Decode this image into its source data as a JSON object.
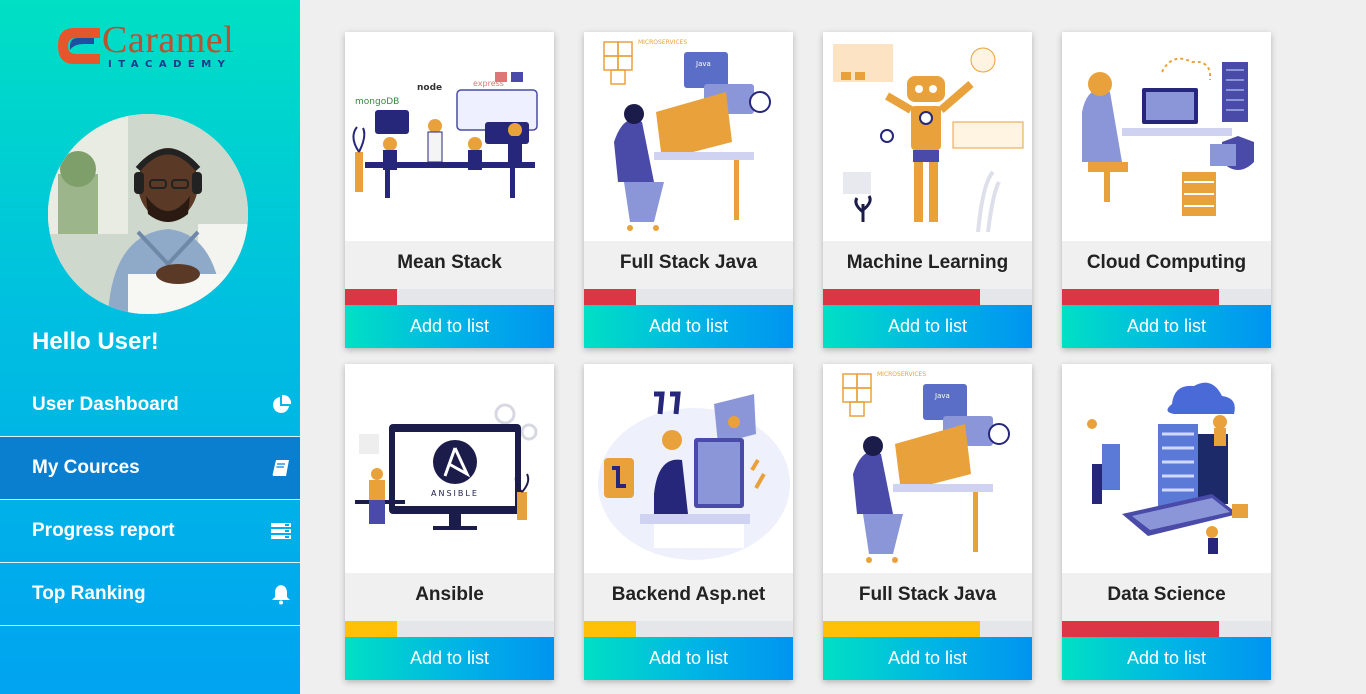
{
  "brand": {
    "name": "Caramel",
    "tagline": "ITACADEMY",
    "colors": {
      "logo_text": "#b9522d",
      "logo_sub": "#1f3a8a"
    }
  },
  "user": {
    "greeting": "Hello User!"
  },
  "sidebar": {
    "items": [
      {
        "label": "User Dashboard",
        "icon": "pie-chart-icon",
        "active": false
      },
      {
        "label": "My Cources",
        "icon": "book-icon",
        "active": true
      },
      {
        "label": "Progress report",
        "icon": "list-icon",
        "active": false
      },
      {
        "label": "Top Ranking",
        "icon": "bell-icon",
        "active": false
      }
    ]
  },
  "courses": [
    {
      "title": "Mean Stack",
      "progress": 0.25,
      "bar_color": "#dc3545",
      "button": "Add to list",
      "image": "mean-stack-illustration"
    },
    {
      "title": "Full Stack Java",
      "progress": 0.25,
      "bar_color": "#dc3545",
      "button": "Add to list",
      "image": "java-developer-illustration"
    },
    {
      "title": "Machine Learning",
      "progress": 0.75,
      "bar_color": "#dc3545",
      "button": "Add to list",
      "image": "robot-illustration"
    },
    {
      "title": "Cloud Computing",
      "progress": 0.75,
      "bar_color": "#dc3545",
      "button": "Add to list",
      "image": "cloud-illustration"
    },
    {
      "title": "Ansible",
      "progress": 0.25,
      "bar_color": "#ffc107",
      "button": "Add to list",
      "image": "ansible-illustration"
    },
    {
      "title": "Backend Asp.net",
      "progress": 0.25,
      "bar_color": "#ffc107",
      "button": "Add to list",
      "image": "backend-illustration"
    },
    {
      "title": "Full Stack Java",
      "progress": 0.75,
      "bar_color": "#ffc107",
      "button": "Add to list",
      "image": "java-developer-illustration"
    },
    {
      "title": "Data Science",
      "progress": 0.75,
      "bar_color": "#dc3545",
      "button": "Add to list",
      "image": "data-science-illustration"
    }
  ],
  "illustration_text": {
    "mongodb": "mongoDB",
    "node": "node",
    "express": "express",
    "microservices": "MICROSERVICES",
    "java": "Java",
    "ansible": "ANSIBLE"
  }
}
